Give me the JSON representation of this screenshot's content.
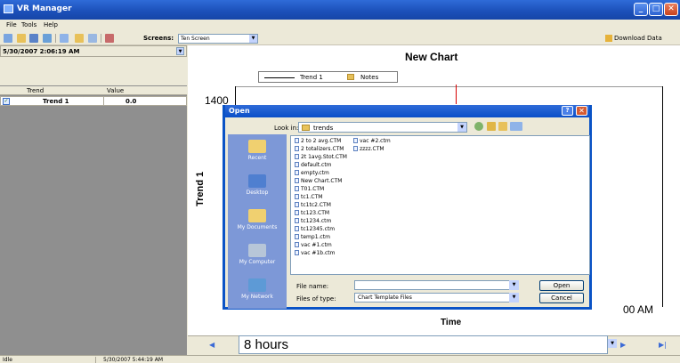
{
  "window": {
    "title": "VR Manager"
  },
  "menu": [
    "File",
    "Tools",
    "Help"
  ],
  "toolbar": {
    "screens_label": "Screens:",
    "screen_value": "Ten Screen",
    "download_label": "Download Data"
  },
  "left_panel": {
    "date": "5/30/2007 2:06:19 AM",
    "columns": [
      "Trend",
      "Value"
    ],
    "rows": [
      {
        "name": "Trend 1",
        "value": "0.0",
        "checked": true
      }
    ]
  },
  "chart_data": {
    "type": "line",
    "title": "New Chart",
    "legend": [
      "Trend 1",
      "Notes"
    ],
    "ylabel": "Trend 1",
    "xlabel": "Time",
    "y_ticks": [
      "1400"
    ],
    "x_ticks": [
      "00 AM"
    ],
    "series": [
      {
        "name": "Trend 1",
        "values": []
      }
    ]
  },
  "nav": {
    "period": "8 hours"
  },
  "status": {
    "left": "Idle",
    "right": "5/30/2007 5:44:19 AM"
  },
  "dialog": {
    "title": "Open",
    "look_in_label": "Look in:",
    "look_in_value": "trends",
    "places": [
      "Recent",
      "Desktop",
      "My Documents",
      "My Computer",
      "My Network"
    ],
    "files_col1": [
      "2 to 2 avg.CTM",
      "2 totalizers.CTM",
      "2t 1avg.Stot.CTM",
      "default.ctm",
      "empty.ctm",
      "New Chart.CTM",
      "T01.CTM",
      "tc1.CTM",
      "tc1tc2.CTM",
      "tc123.CTM",
      "tc1234.ctm",
      "tc12345.ctm",
      "temp1.ctm",
      "vac #1.ctm",
      "vac #1b.ctm"
    ],
    "files_col2": [
      "vac #2.ctm",
      "zzzz.CTM"
    ],
    "file_name_label": "File name:",
    "file_name_value": "",
    "file_type_label": "Files of type:",
    "file_type_value": "Chart Template Files",
    "open_button": "Open",
    "cancel_button": "Cancel"
  }
}
